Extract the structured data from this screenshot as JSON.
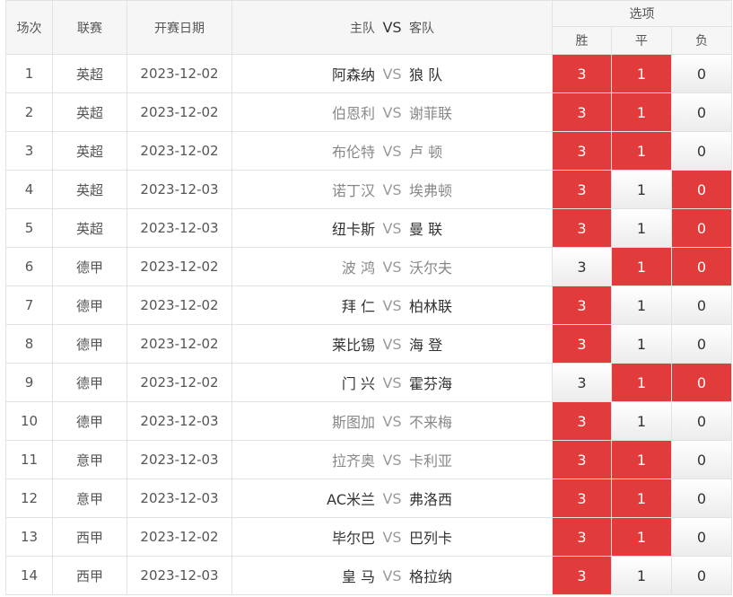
{
  "header": {
    "col_num": "场次",
    "col_league": "联赛",
    "col_date": "开赛日期",
    "col_home": "主队",
    "col_vs": "VS",
    "col_away": "客队",
    "col_options": "选项",
    "opt_win": "胜",
    "opt_draw": "平",
    "opt_lose": "负"
  },
  "colors": {
    "selected": "#e23b3b",
    "unselected": "#f0f0f0"
  },
  "rows": [
    {
      "num": "1",
      "league": "英超",
      "date": "2023-12-02",
      "home": "阿森纳",
      "vs": "VS",
      "away": "狼 队",
      "win": "3",
      "draw": "1",
      "lose": "0",
      "win_sel": true,
      "draw_sel": true,
      "lose_sel": false,
      "home_pri": true
    },
    {
      "num": "2",
      "league": "英超",
      "date": "2023-12-02",
      "home": "伯恩利",
      "vs": "VS",
      "away": "谢菲联",
      "win": "3",
      "draw": "1",
      "lose": "0",
      "win_sel": true,
      "draw_sel": true,
      "lose_sel": false,
      "home_pri": false
    },
    {
      "num": "3",
      "league": "英超",
      "date": "2023-12-02",
      "home": "布伦特",
      "vs": "VS",
      "away": "卢 顿",
      "win": "3",
      "draw": "1",
      "lose": "0",
      "win_sel": true,
      "draw_sel": true,
      "lose_sel": false,
      "home_pri": false
    },
    {
      "num": "4",
      "league": "英超",
      "date": "2023-12-03",
      "home": "诺丁汉",
      "vs": "VS",
      "away": "埃弗顿",
      "win": "3",
      "draw": "1",
      "lose": "0",
      "win_sel": true,
      "draw_sel": false,
      "lose_sel": true,
      "home_pri": false
    },
    {
      "num": "5",
      "league": "英超",
      "date": "2023-12-03",
      "home": "纽卡斯",
      "vs": "VS",
      "away": "曼 联",
      "win": "3",
      "draw": "1",
      "lose": "0",
      "win_sel": true,
      "draw_sel": false,
      "lose_sel": true,
      "home_pri": true
    },
    {
      "num": "6",
      "league": "德甲",
      "date": "2023-12-02",
      "home": "波 鸿",
      "vs": "VS",
      "away": "沃尔夫",
      "win": "3",
      "draw": "1",
      "lose": "0",
      "win_sel": false,
      "draw_sel": true,
      "lose_sel": true,
      "home_pri": false
    },
    {
      "num": "7",
      "league": "德甲",
      "date": "2023-12-02",
      "home": "拜 仁",
      "vs": "VS",
      "away": "柏林联",
      "win": "3",
      "draw": "1",
      "lose": "0",
      "win_sel": true,
      "draw_sel": false,
      "lose_sel": false,
      "home_pri": true
    },
    {
      "num": "8",
      "league": "德甲",
      "date": "2023-12-02",
      "home": "莱比锡",
      "vs": "VS",
      "away": "海 登",
      "win": "3",
      "draw": "1",
      "lose": "0",
      "win_sel": true,
      "draw_sel": false,
      "lose_sel": false,
      "home_pri": true
    },
    {
      "num": "9",
      "league": "德甲",
      "date": "2023-12-02",
      "home": "门 兴",
      "vs": "VS",
      "away": "霍芬海",
      "win": "3",
      "draw": "1",
      "lose": "0",
      "win_sel": false,
      "draw_sel": true,
      "lose_sel": true,
      "home_pri": true
    },
    {
      "num": "10",
      "league": "德甲",
      "date": "2023-12-03",
      "home": "斯图加",
      "vs": "VS",
      "away": "不来梅",
      "win": "3",
      "draw": "1",
      "lose": "0",
      "win_sel": true,
      "draw_sel": false,
      "lose_sel": false,
      "home_pri": false
    },
    {
      "num": "11",
      "league": "意甲",
      "date": "2023-12-03",
      "home": "拉齐奥",
      "vs": "VS",
      "away": "卡利亚",
      "win": "3",
      "draw": "1",
      "lose": "0",
      "win_sel": true,
      "draw_sel": true,
      "lose_sel": false,
      "home_pri": false
    },
    {
      "num": "12",
      "league": "意甲",
      "date": "2023-12-03",
      "home": "AC米兰",
      "vs": "VS",
      "away": "弗洛西",
      "win": "3",
      "draw": "1",
      "lose": "0",
      "win_sel": true,
      "draw_sel": true,
      "lose_sel": false,
      "home_pri": true
    },
    {
      "num": "13",
      "league": "西甲",
      "date": "2023-12-02",
      "home": "毕尔巴",
      "vs": "VS",
      "away": "巴列卡",
      "win": "3",
      "draw": "1",
      "lose": "0",
      "win_sel": true,
      "draw_sel": true,
      "lose_sel": false,
      "home_pri": true
    },
    {
      "num": "14",
      "league": "西甲",
      "date": "2023-12-03",
      "home": "皇 马",
      "vs": "VS",
      "away": "格拉纳",
      "win": "3",
      "draw": "1",
      "lose": "0",
      "win_sel": true,
      "draw_sel": false,
      "lose_sel": false,
      "home_pri": true
    }
  ]
}
